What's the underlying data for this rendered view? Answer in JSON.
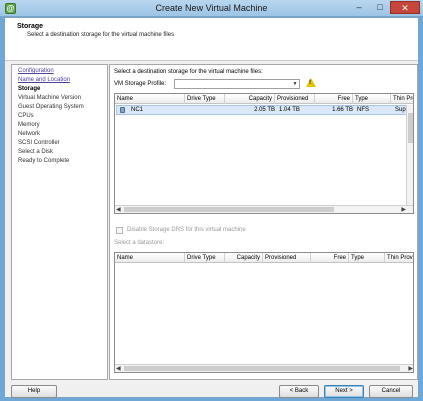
{
  "window": {
    "title": "Create New Virtual Machine",
    "minimize": "–",
    "maximize": "□",
    "close": "✕"
  },
  "header": {
    "title": "Storage",
    "subtitle": "Select a destination storage for the virtual machine files"
  },
  "steps": [
    {
      "label": "Configuration",
      "state": "done"
    },
    {
      "label": "Name and Location",
      "state": "done"
    },
    {
      "label": "Storage",
      "state": "active"
    },
    {
      "label": "Virtual Machine Version",
      "state": "pending"
    },
    {
      "label": "Guest Operating System",
      "state": "pending"
    },
    {
      "label": "CPUs",
      "state": "pending"
    },
    {
      "label": "Memory",
      "state": "pending"
    },
    {
      "label": "Network",
      "state": "pending"
    },
    {
      "label": "SCSI Controller",
      "state": "pending"
    },
    {
      "label": "Select a Disk",
      "state": "pending"
    },
    {
      "label": "Ready to Complete",
      "state": "pending"
    }
  ],
  "content": {
    "select_label": "Select a destination storage for the virtual machine files:",
    "profile_label": "VM Storage Profile:",
    "profile_value": "",
    "columns": [
      "Name",
      "Drive Type",
      "Capacity",
      "Provisioned",
      "Free",
      "Type",
      "Thin Pro"
    ],
    "rows": [
      {
        "name": "NC1",
        "drive_type": "",
        "capacity": "2.05 TB",
        "provisioned": "1.04 TB",
        "free": "1.66 TB",
        "type": "NFS",
        "thin": "Supp"
      }
    ],
    "disable_drs_label": "Disable Storage DRS for this virtual machine",
    "select_datastore_label": "Select a datastore:",
    "columns2": [
      "Name",
      "Drive Type",
      "Capacity",
      "Provisioned",
      "Free",
      "Type",
      "Thin Provi"
    ]
  },
  "buttons": {
    "help": "Help",
    "back": "< Back",
    "next": "Next >",
    "cancel": "Cancel"
  },
  "icons": {
    "app": "vsphere-app-icon",
    "warning": "warning-icon",
    "datastore": "datastore-icon"
  }
}
